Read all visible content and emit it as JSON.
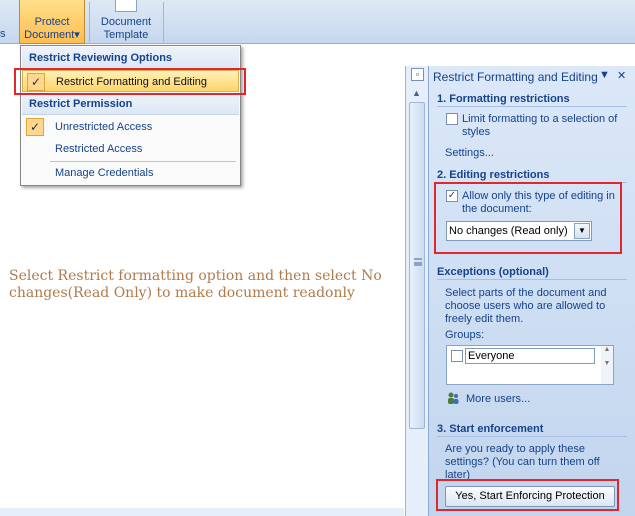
{
  "ribbon": {
    "stub_label": "s",
    "protect": {
      "line1": "Protect",
      "line2": "Document",
      "arrow": "▾"
    },
    "template": {
      "line1": "Document",
      "line2": "Template"
    }
  },
  "menu": {
    "heading_reviewing": "Restrict Reviewing Options",
    "item_restrict_formatting": "Restrict Formatting and Editing",
    "heading_permission": "Restrict Permission",
    "item_unrestricted": "Unrestricted Access",
    "item_restricted": "Restricted Access",
    "item_manage": "Manage Credentials",
    "check_glyph": "✓"
  },
  "document": {
    "instruction": "Select Restrict formatting option and then select No changes(Read Only) to make document readonly"
  },
  "pane": {
    "title": "Restrict Formatting and Editing",
    "dropdown_glyph": "▼",
    "close_glyph": "✕",
    "section1": "1. Formatting restrictions",
    "limit_formatting": "Limit formatting to a selection of styles",
    "settings_link": "Settings...",
    "section2": "2. Editing restrictions",
    "allow_editing": "Allow only this type of editing in the document:",
    "editing_select_value": "No changes (Read only)",
    "exceptions_head": "Exceptions (optional)",
    "exceptions_text": "Select parts of the document and choose users who are allowed to freely edit them.",
    "groups_label": "Groups:",
    "group_everyone": "Everyone",
    "more_users": "More users...",
    "section3": "3. Start enforcement",
    "enforce_text": "Are you ready to apply these settings? (You can turn them off later)",
    "start_button": "Yes, Start Enforcing Protection"
  },
  "colors": {
    "accent": "#15428b",
    "highlight_box": "#e1262e",
    "instruction_text": "#b07a4a"
  }
}
